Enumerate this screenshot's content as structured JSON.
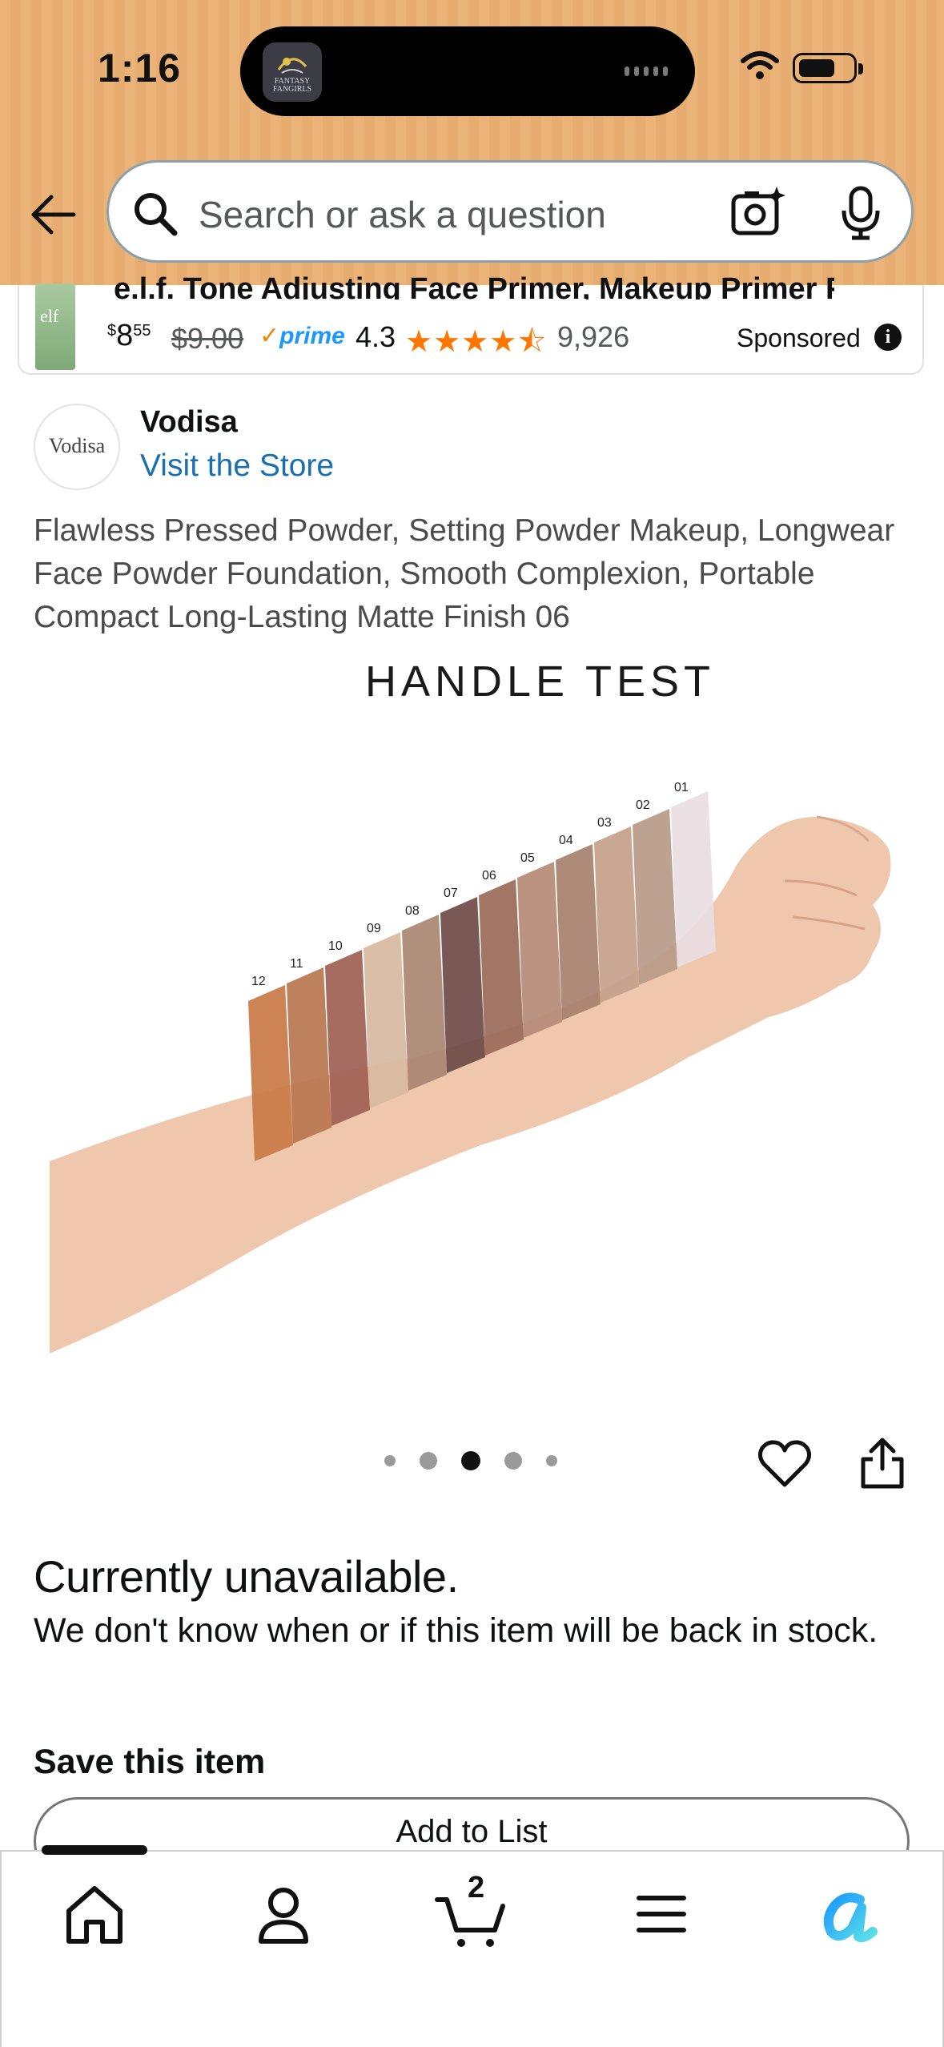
{
  "status_bar": {
    "time": "1:16",
    "island_app_label": "FANTASY FANGIRLS"
  },
  "search": {
    "placeholder": "Search or ask a question"
  },
  "sponsored_ad": {
    "title": "e.l.f. Tone Adjusting Face Primer, Makeup Primer For...",
    "price_whole": "8",
    "price_symbol": "$",
    "price_fraction": "55",
    "list_price": "$9.00",
    "prime_label": "prime",
    "rating": "4.3",
    "stars": "★★★★⯪",
    "review_count": "9,926",
    "sponsored_label": "Sponsored",
    "thumb_brand": "elf"
  },
  "brand": {
    "logo_text": "Vodisa",
    "name": "Vodisa",
    "store_link": "Visit the Store"
  },
  "product": {
    "title": "Flawless Pressed Powder, Setting Powder Makeup, Longwear Face Powder Foundation, Smooth Complexion, Portable Compact Long-Lasting Matte Finish 06",
    "image_caption": "HANDLE TEST",
    "swatch_labels": [
      "12",
      "11",
      "10",
      "09",
      "08",
      "07",
      "06",
      "05",
      "04",
      "03",
      "02",
      "01"
    ],
    "carousel": {
      "count": 5,
      "active_index": 2
    }
  },
  "availability": {
    "status": "Currently unavailable.",
    "description": "We don't know when or if this item will be back in stock.",
    "save_label": "Save this item",
    "add_to_list": "Add to List"
  },
  "bottom_nav": {
    "cart_count": "2",
    "items": [
      "home-icon",
      "account-icon",
      "cart-icon",
      "menu-icon",
      "rufus-icon"
    ]
  },
  "colors": {
    "header_bg": "#ebb378",
    "link_blue": "#1a6fb0",
    "star_orange": "#ff7700",
    "prime_blue": "#1a98ff"
  }
}
